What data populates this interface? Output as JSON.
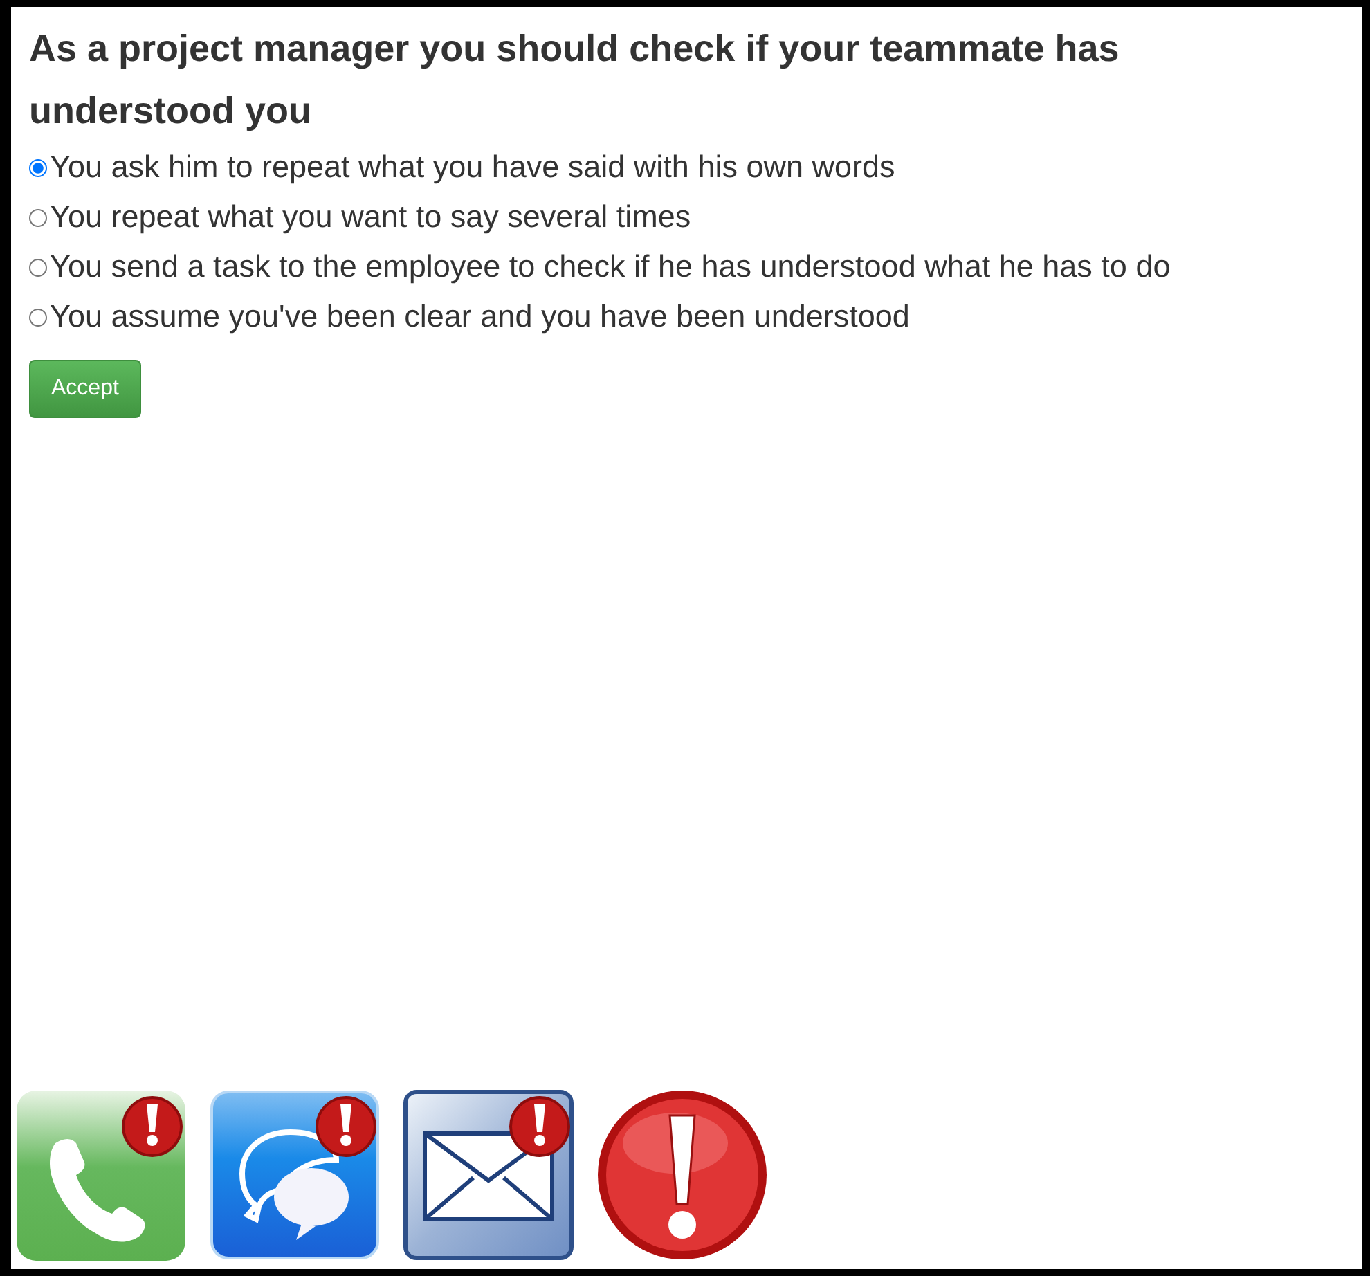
{
  "question": "As a project manager you should check if your teammate has understood you",
  "options": [
    {
      "label": "You ask him to repeat what you have said with his own words",
      "selected": true
    },
    {
      "label": "You repeat what you want to say several times",
      "selected": false
    },
    {
      "label": "You send a task to the employee to check if he has understood what he has to do",
      "selected": false
    },
    {
      "label": "You assume you've been clear and you have been understood",
      "selected": false
    }
  ],
  "accept_button": "Accept",
  "apps": [
    {
      "kind": "phone",
      "alert": true
    },
    {
      "kind": "chat",
      "alert": true
    },
    {
      "kind": "mail",
      "alert": true
    },
    {
      "kind": "warning",
      "alert": false
    }
  ]
}
